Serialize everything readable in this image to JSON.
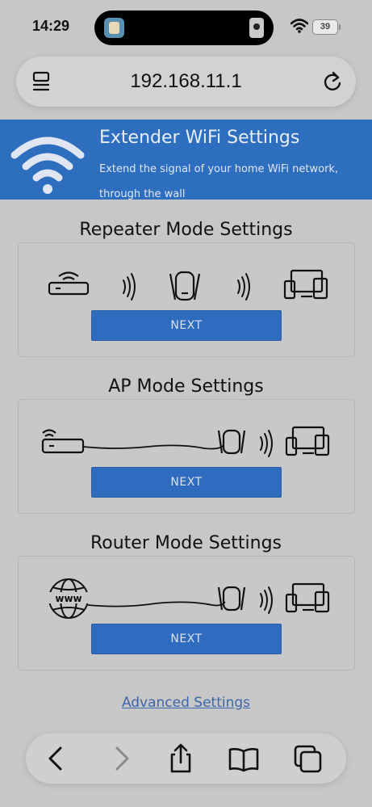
{
  "status_bar": {
    "time": "14:29",
    "battery": "39"
  },
  "browser": {
    "url": "192.168.11.1"
  },
  "banner": {
    "title": "Extender WiFi Settings",
    "subtitle": "Extend the signal of your home WiFi network, through the wall"
  },
  "modes": [
    {
      "title": "Repeater Mode Settings",
      "button": "NEXT"
    },
    {
      "title": "AP Mode Settings",
      "button": "NEXT"
    },
    {
      "title": "Router Mode Settings",
      "button": "NEXT"
    }
  ],
  "advanced_link": "Advanced Settings",
  "colors": {
    "banner": "#2e6ebf",
    "button": "#2f6cc0",
    "link": "#3c66aa",
    "background": "#c7c7c7"
  },
  "icons": [
    "reader-icon",
    "reload-icon",
    "back-icon",
    "forward-icon",
    "share-icon",
    "bookmarks-icon",
    "tabs-icon",
    "wifi-icon",
    "router-icon",
    "extender-icon",
    "devices-icon",
    "globe-icon",
    "signal-waves-icon"
  ]
}
